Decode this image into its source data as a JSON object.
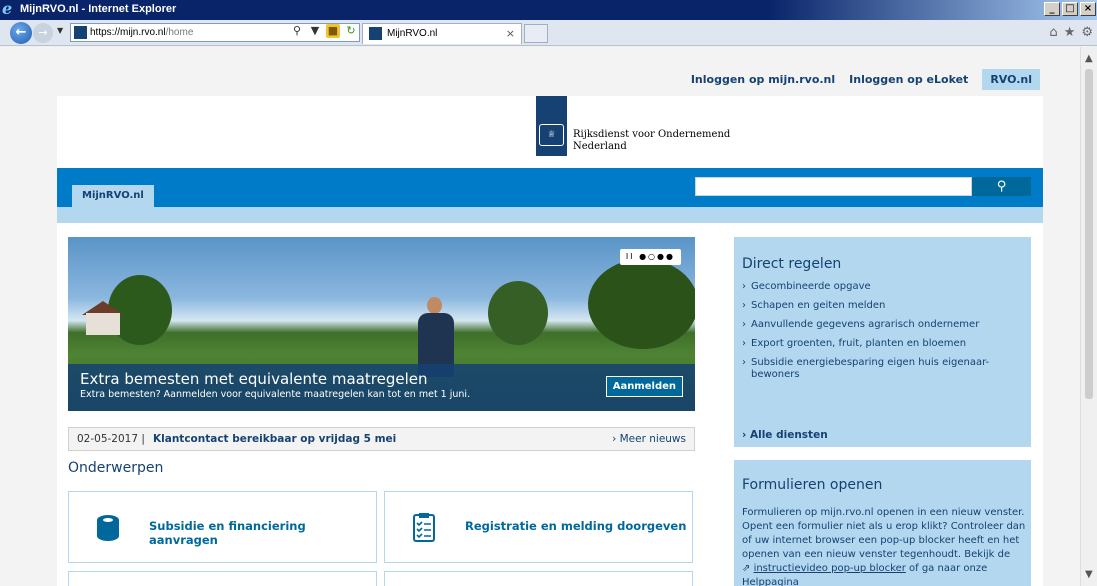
{
  "window": {
    "title": "MijnRVO.nl - Internet Explorer",
    "controls": [
      "_",
      "□",
      "×"
    ]
  },
  "browser": {
    "url_prefix": "https://mijn.rvo.nl",
    "url_rest": "/home",
    "tab_label": "MijnRVO.nl",
    "tab_close": "×"
  },
  "toplinks": {
    "mijn_rvo": "Inloggen op mijn.rvo.nl",
    "eloket": "Inloggen op eLoket",
    "rvo": "RVO.nl"
  },
  "logo": {
    "line1": "Rijksdienst voor Ondernemend",
    "line2": "Nederland"
  },
  "nav": {
    "tab": "MijnRVO.nl",
    "search_placeholder": ""
  },
  "hero": {
    "heading": "Extra bemesten met equivalente maatregelen",
    "subtext": "Extra bemesten? Aanmelden voor equivalente maatregelen kan tot en met 1 juni.",
    "cta": "Aanmelden",
    "carousel": "II ●○●●"
  },
  "news": {
    "date": "02-05-2017 |",
    "title": "Klantcontact bereikbaar op vrijdag 5 mei",
    "more": "Meer nieuws"
  },
  "onderwerpen": {
    "heading": "Onderwerpen",
    "cards": [
      {
        "label": "Subsidie en financiering aanvragen",
        "icon": "coins-icon"
      },
      {
        "label": "Registratie en melding doorgeven",
        "icon": "clipboard-checklist-icon"
      }
    ]
  },
  "direct_regelen": {
    "heading": "Direct regelen",
    "items": [
      "Gecombineerde opgave",
      "Schapen en geiten melden",
      "Aanvullende gegevens agrarisch ondernemer",
      "Export groenten, fruit, planten en bloemen",
      "Subsidie energiebesparing eigen huis eigenaar-bewoners"
    ],
    "all": "Alle diensten"
  },
  "formulieren": {
    "heading": "Formulieren openen",
    "text": "Formulieren op mijn.rvo.nl openen in een nieuw venster. Opent een formulier niet als u erop klikt? Controleer dan of uw internet browser een pop-up blocker heeft en het openen van een nieuw venster tegenhoudt. Bekijk de",
    "link": "instructievideo pop-up blocker",
    "text_after": "of ga naar onze",
    "link2": "Helppagina"
  },
  "colors": {
    "primary": "#154273",
    "accent_blue": "#007bc7",
    "light_blue": "#b2d7ee",
    "button_blue": "#01689b"
  }
}
